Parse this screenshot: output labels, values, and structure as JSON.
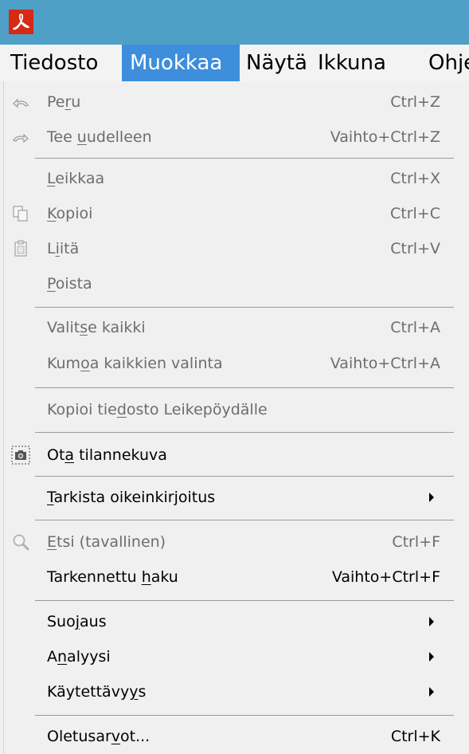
{
  "menubar": {
    "items": [
      "Tiedosto",
      "Muokkaa",
      "Näytä",
      "Ikkuna",
      "Ohje"
    ]
  },
  "menu": {
    "peru": {
      "pre": "Pe",
      "u": "r",
      "post": "u",
      "shortcut": "Ctrl+Z"
    },
    "tee_uudelleen": {
      "pre": "Tee ",
      "u": "u",
      "post": "udelleen",
      "shortcut": "Vaihto+Ctrl+Z"
    },
    "leikkaa": {
      "pre": "",
      "u": "L",
      "post": "eikkaa",
      "shortcut": "Ctrl+X"
    },
    "kopioi": {
      "pre": "",
      "u": "K",
      "post": "opioi",
      "shortcut": "Ctrl+C"
    },
    "liita": {
      "pre": "L",
      "u": "i",
      "post": "itä",
      "shortcut": "Ctrl+V"
    },
    "poista": {
      "pre": "",
      "u": "P",
      "post": "oista"
    },
    "valitse_kaikki": {
      "pre": "Valit",
      "u": "s",
      "post": "e kaikki",
      "shortcut": "Ctrl+A"
    },
    "kumoa_valinta": {
      "pre": "Kum",
      "u": "o",
      "post": "a kaikkien valinta",
      "shortcut": "Vaihto+Ctrl+A"
    },
    "kopioi_tiedosto": {
      "pre": "Kopioi tie",
      "u": "d",
      "post": "osto Leikepöydälle"
    },
    "ota_tilannekuva": {
      "pre": "Ot",
      "u": "a",
      "post": " tilannekuva"
    },
    "tarkista": {
      "pre": "",
      "u": "T",
      "post": "arkista oikeinkirjoitus"
    },
    "etsi": {
      "pre": "",
      "u": "E",
      "post": "tsi (tavallinen)",
      "shortcut": "Ctrl+F"
    },
    "tarkennettu_haku": {
      "pre": "Tarkennettu ",
      "u": "h",
      "post": "aku",
      "shortcut": "Vaihto+Ctrl+F"
    },
    "suojaus": {
      "pre": "Suo",
      "u": "j",
      "post": "aus"
    },
    "analyysi": {
      "pre": "A",
      "u": "n",
      "post": "alyysi"
    },
    "kaytettavyys": {
      "pre": "Käytettävy",
      "u": "y",
      "post": "s"
    },
    "oletusarvot": {
      "pre": "Oletusar",
      "u": "v",
      "post": "ot...",
      "shortcut": "Ctrl+K"
    }
  },
  "icons": {
    "app": "acrobat-logo-icon",
    "undo": "undo-icon",
    "redo": "redo-icon",
    "copy": "copy-icon",
    "paste": "clipboard-icon",
    "snapshot": "camera-icon",
    "search": "magnifier-icon",
    "submenu": "submenu-arrow-icon"
  },
  "colors": {
    "titlebar": "#4fa0c6",
    "menu_highlight": "#3e8edc",
    "menu_bg": "#f0f0f0",
    "disabled_text": "#6d6d6d"
  }
}
